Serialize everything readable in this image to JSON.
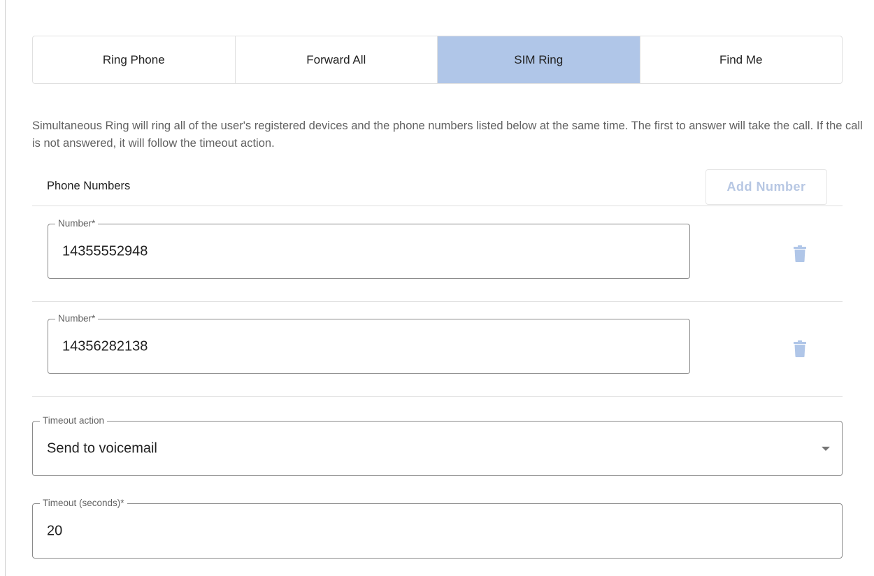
{
  "tabs": [
    {
      "label": "Ring Phone",
      "active": false
    },
    {
      "label": "Forward All",
      "active": false
    },
    {
      "label": "SIM Ring",
      "active": true
    },
    {
      "label": "Find Me",
      "active": false
    }
  ],
  "description": "Simultaneous Ring will ring all of the user's registered devices and the phone numbers listed below at the same time. The first to answer will take the call. If the call is not answered, it will follow the timeout action.",
  "phone_numbers": {
    "title": "Phone Numbers",
    "add_button_label": "Add Number",
    "add_button_disabled": true,
    "items": [
      {
        "label": "Number*",
        "value": "14355552948",
        "delete_icon": "trash-icon"
      },
      {
        "label": "Number*",
        "value": "14356282138",
        "delete_icon": "trash-icon"
      }
    ]
  },
  "timeout_action": {
    "label": "Timeout action",
    "value": "Send to voicemail",
    "icon": "caret-down-icon"
  },
  "timeout_seconds": {
    "label": "Timeout (seconds)*",
    "value": "20"
  },
  "colors": {
    "active_tab": "#b0c6e8",
    "disabled_button_text": "#b7c7e3",
    "trash_icon": "#b0c6e8"
  }
}
